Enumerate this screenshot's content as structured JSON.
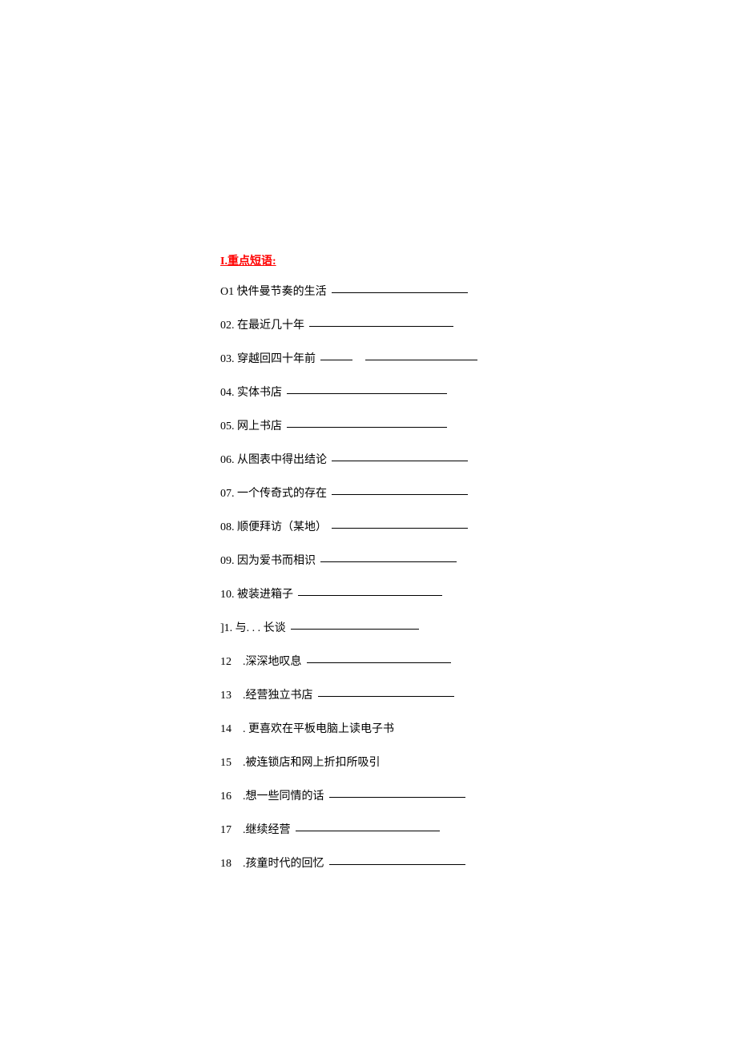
{
  "heading": "I.重点短语:",
  "items": [
    {
      "num": "O1",
      "text": "快件曼节奏的生活",
      "spaced": false
    },
    {
      "num": "02.",
      "text": "在最近几十年",
      "spaced": false
    },
    {
      "num": "03.",
      "text": "穿越回四十年前",
      "spaced": false,
      "split": true
    },
    {
      "num": "04.",
      "text": "实体书店",
      "spaced": false
    },
    {
      "num": "05.",
      "text": "网上书店",
      "spaced": false
    },
    {
      "num": "06.",
      "text": "从图表中得出结论",
      "spaced": false
    },
    {
      "num": "07.",
      "text": "一个传奇式的存在",
      "spaced": false
    },
    {
      "num": "08.",
      "text": "顺便拜访（某地）",
      "spaced": false
    },
    {
      "num": "09.",
      "text": "因为爱书而相识",
      "spaced": false
    },
    {
      "num": "10.",
      "text": "被装进箱子",
      "spaced": false
    },
    {
      "num": "]1.",
      "text": "与. . . 长谈",
      "spaced": false
    },
    {
      "num": "12",
      "text": ".深深地叹息",
      "spaced": true
    },
    {
      "num": "13",
      "text": ".经营独立书店",
      "spaced": true
    },
    {
      "num": "14",
      "text": ". 更喜欢在平板电脑上读电子书",
      "spaced": true,
      "noline": true
    },
    {
      "num": "15",
      "text": ".被连锁店和网上折扣所吸引",
      "spaced": true,
      "noline": true
    },
    {
      "num": "16",
      "text": ".想一些同情的话",
      "spaced": true
    },
    {
      "num": "17",
      "text": ".继续经营",
      "spaced": true
    },
    {
      "num": "18",
      "text": ".孩童时代的回忆",
      "spaced": true
    }
  ]
}
